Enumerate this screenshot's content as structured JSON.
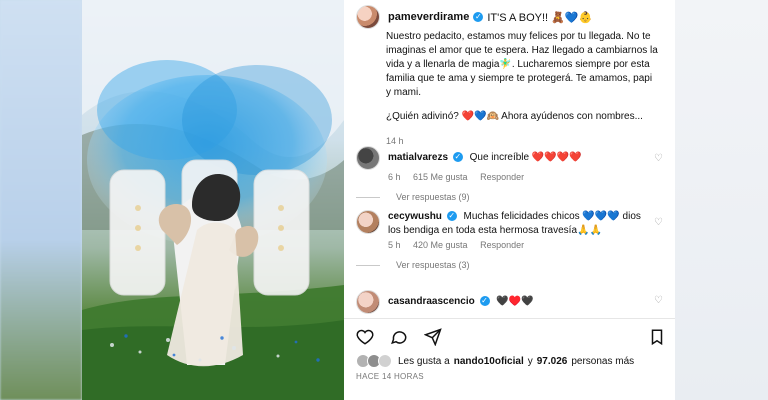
{
  "post": {
    "username": "pameverdirame",
    "title": "IT'S A BOY!! 🧸💙👶",
    "caption_paragraphs": [
      "Nuestro pedacito, estamos muy felices por tu llegada. No te imaginas el amor que te espera. Haz llegado a cambiarnos la vida y a llenarla de magia🧚‍♂️. Lucharemos siempre por esta familia que te ama y siempre te protegerá. Te amamos, papi y mami.",
      "¿Quién adivinó? ❤️💙🙉 Ahora ayúdenos con nombres..."
    ],
    "caption_time": "14 h"
  },
  "comments": [
    {
      "username": "matialvarezs",
      "text": "Que increíble ❤️❤️❤️❤️",
      "meta": {
        "time": "6 h",
        "likes": "615 Me gusta",
        "reply": "Responder"
      },
      "replies": "Ver respuestas (9)"
    },
    {
      "username": "cecywushu",
      "text": "Muchas felicidades chicos 💙💙💙 dios los bendiga en toda esta hermosa travesía🙏🙏",
      "meta": {
        "time": "5 h",
        "likes": "420 Me gusta",
        "reply": "Responder"
      },
      "replies": "Ver respuestas (3)"
    },
    {
      "username": "casandraascencio",
      "text": "🖤♥️🖤",
      "meta": {
        "time": "",
        "likes": "",
        "reply": ""
      },
      "replies": ""
    }
  ],
  "actions": {
    "like_icon": "heart-icon",
    "comment_icon": "comment-icon",
    "share_icon": "share-icon",
    "save_icon": "bookmark-icon"
  },
  "likes": {
    "prefix": "Les gusta a",
    "user": "nando10oficial",
    "middle": "y",
    "count": "97.026",
    "suffix": "personas más"
  },
  "when": "HACE 14 HORAS",
  "media": {
    "text_left": "B",
    "text_right": "Y",
    "text_mid": "O"
  }
}
